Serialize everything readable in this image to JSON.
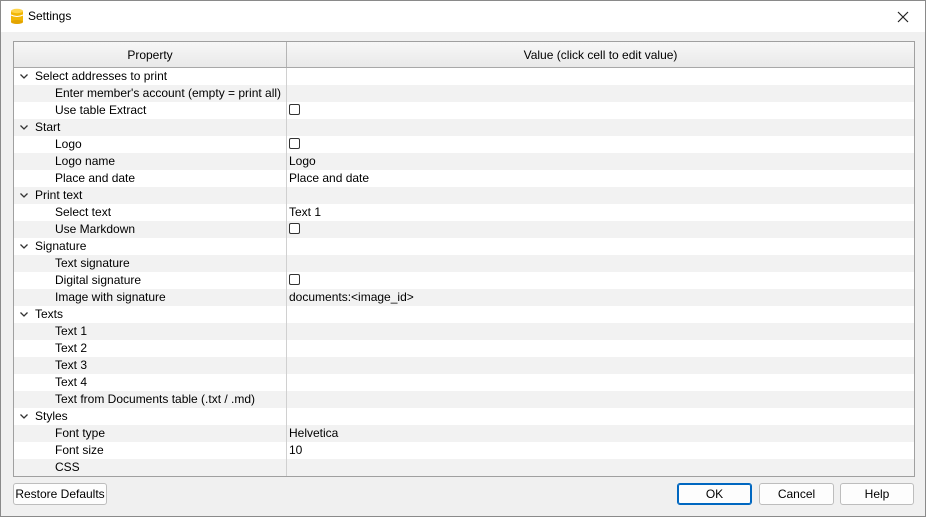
{
  "window": {
    "title": "Settings",
    "app_icon": "database-cylinder-icon",
    "close_icon": "close-icon"
  },
  "grid": {
    "columns": [
      "Property",
      "Value (click cell to edit value)"
    ],
    "rows": [
      {
        "kind": "group",
        "label": "Select addresses to print",
        "expanded": true
      },
      {
        "kind": "child",
        "label": "Enter member's account (empty = print all)",
        "value": ""
      },
      {
        "kind": "child",
        "label": "Use table Extract",
        "checkbox": false
      },
      {
        "kind": "group",
        "label": "Start",
        "expanded": true
      },
      {
        "kind": "child",
        "label": "Logo",
        "checkbox": false
      },
      {
        "kind": "child",
        "label": "Logo name",
        "value": "Logo"
      },
      {
        "kind": "child",
        "label": "Place and date",
        "value": "Place and date"
      },
      {
        "kind": "group",
        "label": "Print text",
        "expanded": true
      },
      {
        "kind": "child",
        "label": "Select text",
        "value": "Text 1"
      },
      {
        "kind": "child",
        "label": "Use Markdown",
        "checkbox": false
      },
      {
        "kind": "group",
        "label": "Signature",
        "expanded": true
      },
      {
        "kind": "child",
        "label": "Text signature",
        "value": ""
      },
      {
        "kind": "child",
        "label": "Digital signature",
        "checkbox": false
      },
      {
        "kind": "child",
        "label": "Image with signature",
        "value": "documents:<image_id>"
      },
      {
        "kind": "group",
        "label": "Texts",
        "expanded": true
      },
      {
        "kind": "child",
        "label": "Text 1",
        "value": ""
      },
      {
        "kind": "child",
        "label": "Text 2",
        "value": ""
      },
      {
        "kind": "child",
        "label": "Text 3",
        "value": ""
      },
      {
        "kind": "child",
        "label": "Text 4",
        "value": ""
      },
      {
        "kind": "child",
        "label": "Text from Documents table (.txt / .md)",
        "value": ""
      },
      {
        "kind": "group",
        "label": "Styles",
        "expanded": true
      },
      {
        "kind": "child",
        "label": "Font type",
        "value": "Helvetica"
      },
      {
        "kind": "child",
        "label": "Font size",
        "value": "10"
      },
      {
        "kind": "child",
        "label": "CSS",
        "value": ""
      }
    ]
  },
  "buttons": {
    "restore": "Restore Defaults",
    "ok": "OK",
    "cancel": "Cancel",
    "help": "Help"
  },
  "colors": {
    "accent": "#0067c0",
    "icon_yellow": "#f2b705",
    "alt_row": "#f2f2f2"
  }
}
